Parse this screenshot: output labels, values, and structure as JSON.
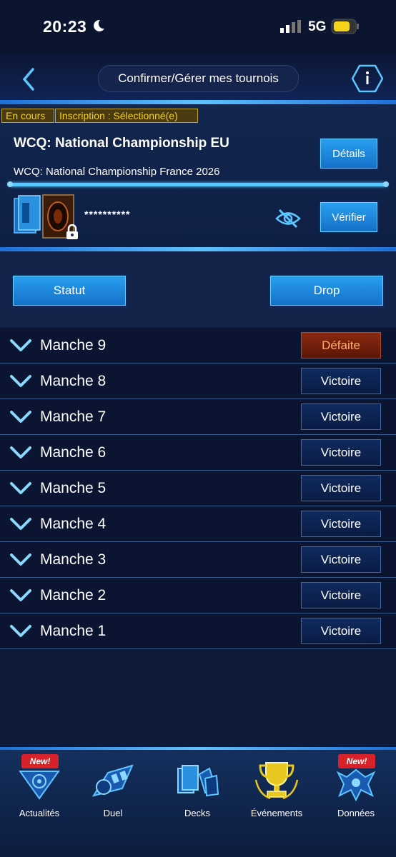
{
  "status_bar": {
    "time": "20:23",
    "network": "5G"
  },
  "nav": {
    "title": "Confirmer/Gérer mes tournois"
  },
  "tournament": {
    "tag_status": "En cours",
    "tag_registration": "Inscription : Sélectionné(e)",
    "name": "WCQ: National Championship EU",
    "subtitle": "WCQ: National Championship France 2026",
    "details_label": "Détails",
    "progress": 1.0,
    "deck_code": "**********",
    "verify_label": "Vérifier"
  },
  "actions": {
    "status_label": "Statut",
    "drop_label": "Drop"
  },
  "rounds": [
    {
      "label": "Manche 9",
      "result": "Défaite",
      "outcome": "loss"
    },
    {
      "label": "Manche 8",
      "result": "Victoire",
      "outcome": "win"
    },
    {
      "label": "Manche 7",
      "result": "Victoire",
      "outcome": "win"
    },
    {
      "label": "Manche 6",
      "result": "Victoire",
      "outcome": "win"
    },
    {
      "label": "Manche 5",
      "result": "Victoire",
      "outcome": "win"
    },
    {
      "label": "Manche 4",
      "result": "Victoire",
      "outcome": "win"
    },
    {
      "label": "Manche 3",
      "result": "Victoire",
      "outcome": "win"
    },
    {
      "label": "Manche 2",
      "result": "Victoire",
      "outcome": "win"
    },
    {
      "label": "Manche 1",
      "result": "Victoire",
      "outcome": "win"
    }
  ],
  "bottom_nav": [
    {
      "label": "Actualités",
      "badge": "New!",
      "icon": "news-icon"
    },
    {
      "label": "Duel",
      "badge": "",
      "icon": "duel-icon"
    },
    {
      "label": "Decks",
      "badge": "",
      "icon": "decks-icon"
    },
    {
      "label": "Événements",
      "badge": "",
      "icon": "trophy-icon"
    },
    {
      "label": "Données",
      "badge": "New!",
      "icon": "data-icon"
    }
  ],
  "colors": {
    "accent": "#5cc6ff",
    "loss": "#8a2a10",
    "tag": "#f5d21d"
  }
}
